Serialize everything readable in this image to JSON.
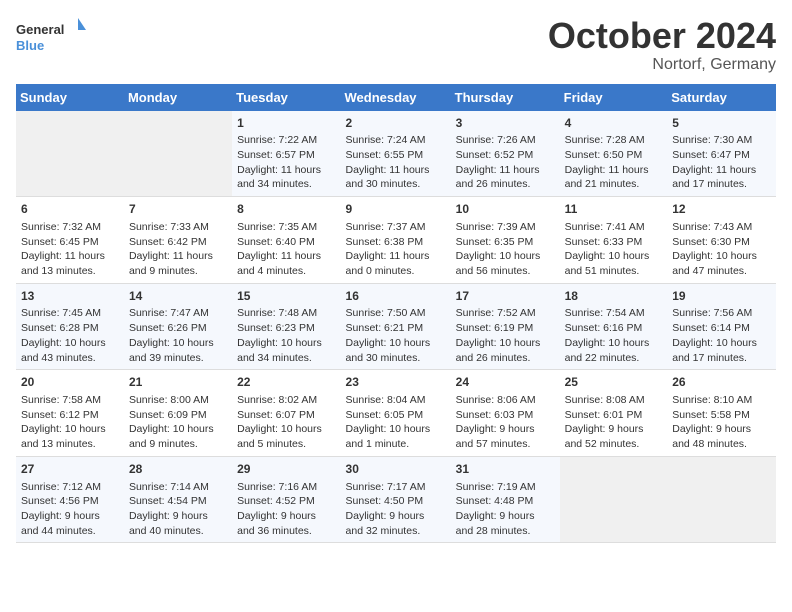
{
  "header": {
    "logo_line1": "General",
    "logo_line2": "Blue",
    "month": "October 2024",
    "location": "Nortorf, Germany"
  },
  "days_of_week": [
    "Sunday",
    "Monday",
    "Tuesday",
    "Wednesday",
    "Thursday",
    "Friday",
    "Saturday"
  ],
  "weeks": [
    [
      {
        "day": "",
        "text": ""
      },
      {
        "day": "",
        "text": ""
      },
      {
        "day": "1",
        "text": "Sunrise: 7:22 AM\nSunset: 6:57 PM\nDaylight: 11 hours\nand 34 minutes."
      },
      {
        "day": "2",
        "text": "Sunrise: 7:24 AM\nSunset: 6:55 PM\nDaylight: 11 hours\nand 30 minutes."
      },
      {
        "day": "3",
        "text": "Sunrise: 7:26 AM\nSunset: 6:52 PM\nDaylight: 11 hours\nand 26 minutes."
      },
      {
        "day": "4",
        "text": "Sunrise: 7:28 AM\nSunset: 6:50 PM\nDaylight: 11 hours\nand 21 minutes."
      },
      {
        "day": "5",
        "text": "Sunrise: 7:30 AM\nSunset: 6:47 PM\nDaylight: 11 hours\nand 17 minutes."
      }
    ],
    [
      {
        "day": "6",
        "text": "Sunrise: 7:32 AM\nSunset: 6:45 PM\nDaylight: 11 hours\nand 13 minutes."
      },
      {
        "day": "7",
        "text": "Sunrise: 7:33 AM\nSunset: 6:42 PM\nDaylight: 11 hours\nand 9 minutes."
      },
      {
        "day": "8",
        "text": "Sunrise: 7:35 AM\nSunset: 6:40 PM\nDaylight: 11 hours\nand 4 minutes."
      },
      {
        "day": "9",
        "text": "Sunrise: 7:37 AM\nSunset: 6:38 PM\nDaylight: 11 hours\nand 0 minutes."
      },
      {
        "day": "10",
        "text": "Sunrise: 7:39 AM\nSunset: 6:35 PM\nDaylight: 10 hours\nand 56 minutes."
      },
      {
        "day": "11",
        "text": "Sunrise: 7:41 AM\nSunset: 6:33 PM\nDaylight: 10 hours\nand 51 minutes."
      },
      {
        "day": "12",
        "text": "Sunrise: 7:43 AM\nSunset: 6:30 PM\nDaylight: 10 hours\nand 47 minutes."
      }
    ],
    [
      {
        "day": "13",
        "text": "Sunrise: 7:45 AM\nSunset: 6:28 PM\nDaylight: 10 hours\nand 43 minutes."
      },
      {
        "day": "14",
        "text": "Sunrise: 7:47 AM\nSunset: 6:26 PM\nDaylight: 10 hours\nand 39 minutes."
      },
      {
        "day": "15",
        "text": "Sunrise: 7:48 AM\nSunset: 6:23 PM\nDaylight: 10 hours\nand 34 minutes."
      },
      {
        "day": "16",
        "text": "Sunrise: 7:50 AM\nSunset: 6:21 PM\nDaylight: 10 hours\nand 30 minutes."
      },
      {
        "day": "17",
        "text": "Sunrise: 7:52 AM\nSunset: 6:19 PM\nDaylight: 10 hours\nand 26 minutes."
      },
      {
        "day": "18",
        "text": "Sunrise: 7:54 AM\nSunset: 6:16 PM\nDaylight: 10 hours\nand 22 minutes."
      },
      {
        "day": "19",
        "text": "Sunrise: 7:56 AM\nSunset: 6:14 PM\nDaylight: 10 hours\nand 17 minutes."
      }
    ],
    [
      {
        "day": "20",
        "text": "Sunrise: 7:58 AM\nSunset: 6:12 PM\nDaylight: 10 hours\nand 13 minutes."
      },
      {
        "day": "21",
        "text": "Sunrise: 8:00 AM\nSunset: 6:09 PM\nDaylight: 10 hours\nand 9 minutes."
      },
      {
        "day": "22",
        "text": "Sunrise: 8:02 AM\nSunset: 6:07 PM\nDaylight: 10 hours\nand 5 minutes."
      },
      {
        "day": "23",
        "text": "Sunrise: 8:04 AM\nSunset: 6:05 PM\nDaylight: 10 hours\nand 1 minute."
      },
      {
        "day": "24",
        "text": "Sunrise: 8:06 AM\nSunset: 6:03 PM\nDaylight: 9 hours\nand 57 minutes."
      },
      {
        "day": "25",
        "text": "Sunrise: 8:08 AM\nSunset: 6:01 PM\nDaylight: 9 hours\nand 52 minutes."
      },
      {
        "day": "26",
        "text": "Sunrise: 8:10 AM\nSunset: 5:58 PM\nDaylight: 9 hours\nand 48 minutes."
      }
    ],
    [
      {
        "day": "27",
        "text": "Sunrise: 7:12 AM\nSunset: 4:56 PM\nDaylight: 9 hours\nand 44 minutes."
      },
      {
        "day": "28",
        "text": "Sunrise: 7:14 AM\nSunset: 4:54 PM\nDaylight: 9 hours\nand 40 minutes."
      },
      {
        "day": "29",
        "text": "Sunrise: 7:16 AM\nSunset: 4:52 PM\nDaylight: 9 hours\nand 36 minutes."
      },
      {
        "day": "30",
        "text": "Sunrise: 7:17 AM\nSunset: 4:50 PM\nDaylight: 9 hours\nand 32 minutes."
      },
      {
        "day": "31",
        "text": "Sunrise: 7:19 AM\nSunset: 4:48 PM\nDaylight: 9 hours\nand 28 minutes."
      },
      {
        "day": "",
        "text": ""
      },
      {
        "day": "",
        "text": ""
      }
    ]
  ]
}
